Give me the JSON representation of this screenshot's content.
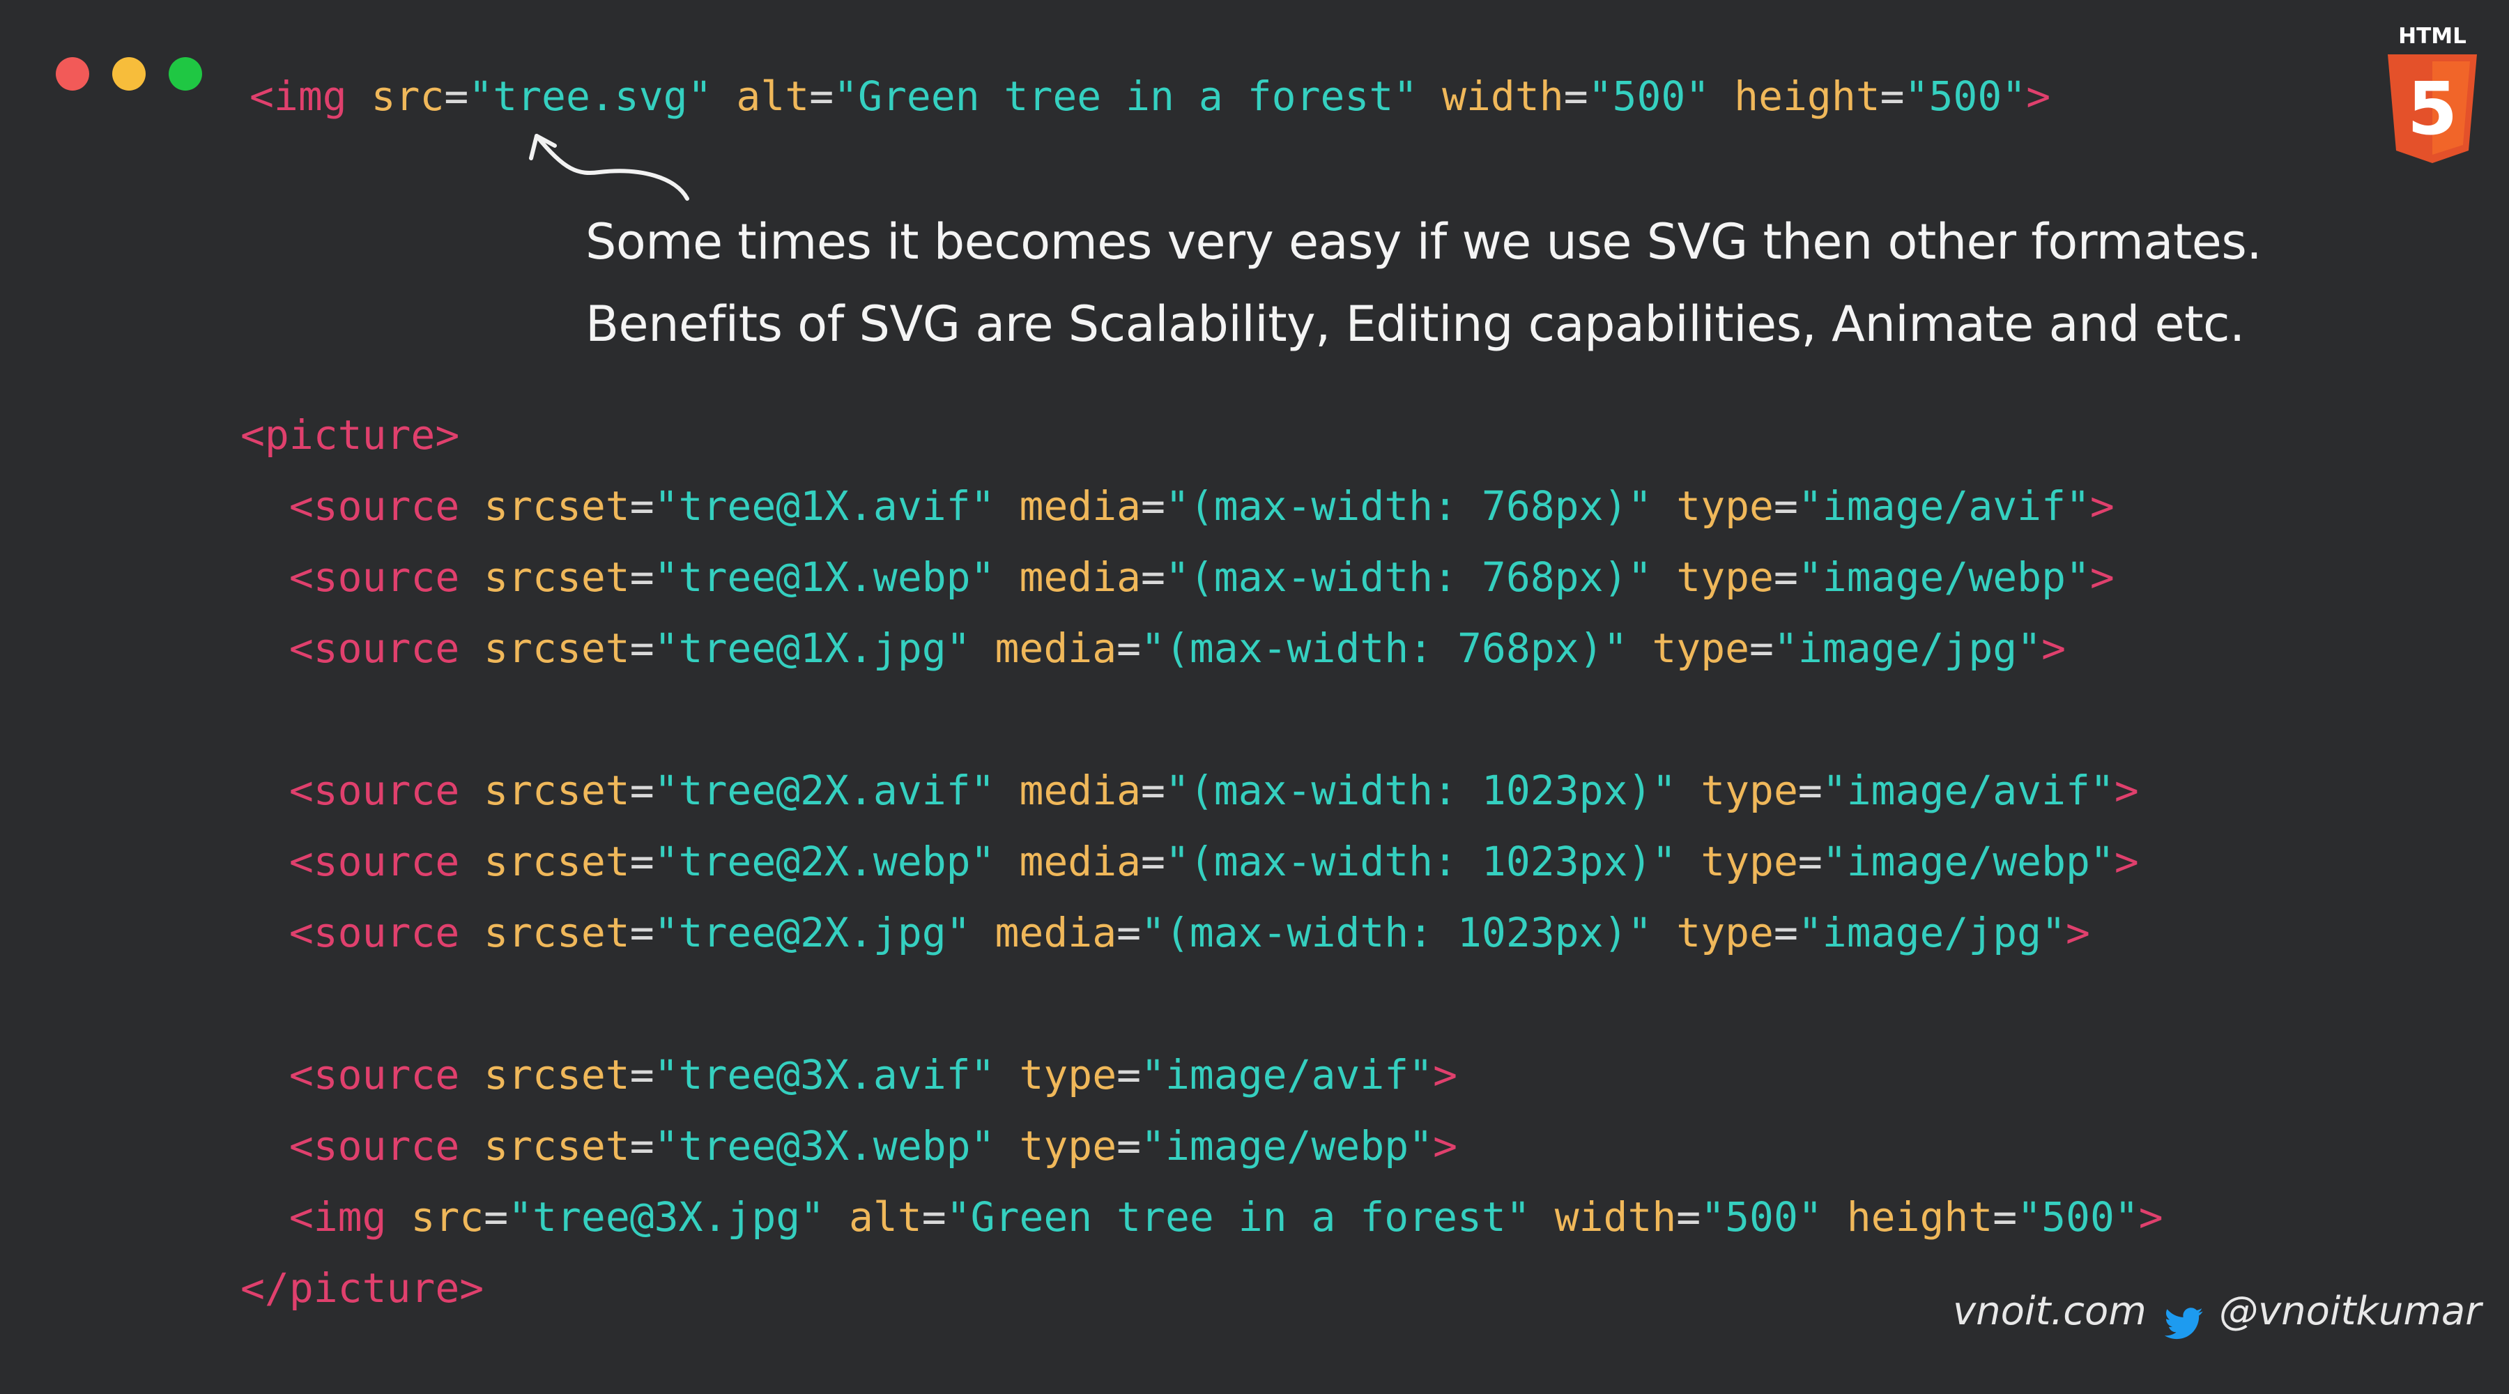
{
  "window_controls": {
    "close_color": "#f25a58",
    "minimize_color": "#f7bd3b",
    "maximize_color": "#1fc743"
  },
  "badge": {
    "label": "HTML",
    "number": "5",
    "orange": "#e4512a",
    "light_orange": "#f16529"
  },
  "code_top": {
    "line": [
      {
        "t": "tag",
        "v": "<img "
      },
      {
        "t": "attr",
        "v": "src"
      },
      {
        "t": "eq",
        "v": "="
      },
      {
        "t": "str",
        "v": "\"tree.svg\""
      },
      {
        "t": "eq",
        "v": " "
      },
      {
        "t": "attr",
        "v": "alt"
      },
      {
        "t": "eq",
        "v": "="
      },
      {
        "t": "str",
        "v": "\"Green tree in a forest\""
      },
      {
        "t": "eq",
        "v": " "
      },
      {
        "t": "attr",
        "v": "width"
      },
      {
        "t": "eq",
        "v": "="
      },
      {
        "t": "str",
        "v": "\"500\""
      },
      {
        "t": "eq",
        "v": " "
      },
      {
        "t": "attr",
        "v": "height"
      },
      {
        "t": "eq",
        "v": "="
      },
      {
        "t": "str",
        "v": "\"500\""
      },
      {
        "t": "tag",
        "v": ">"
      }
    ]
  },
  "annotation": {
    "line1": "Some times it becomes very easy if we use SVG then other formates.",
    "line2": "Benefits of SVG are Scalability, Editing capabilities, Animate and etc."
  },
  "picture_block": [
    [
      {
        "t": "tag",
        "v": "<picture>"
      }
    ],
    [
      {
        "t": "eq",
        "v": "  "
      },
      {
        "t": "tag",
        "v": "<source "
      },
      {
        "t": "attr",
        "v": "srcset"
      },
      {
        "t": "eq",
        "v": "="
      },
      {
        "t": "str",
        "v": "\"tree@1X.avif\""
      },
      {
        "t": "eq",
        "v": " "
      },
      {
        "t": "attr",
        "v": "media"
      },
      {
        "t": "eq",
        "v": "="
      },
      {
        "t": "str",
        "v": "\"(max-width: 768px)\""
      },
      {
        "t": "eq",
        "v": " "
      },
      {
        "t": "attr",
        "v": "type"
      },
      {
        "t": "eq",
        "v": "="
      },
      {
        "t": "str",
        "v": "\"image/avif\""
      },
      {
        "t": "tag",
        "v": ">"
      }
    ],
    [
      {
        "t": "eq",
        "v": "  "
      },
      {
        "t": "tag",
        "v": "<source "
      },
      {
        "t": "attr",
        "v": "srcset"
      },
      {
        "t": "eq",
        "v": "="
      },
      {
        "t": "str",
        "v": "\"tree@1X.webp\""
      },
      {
        "t": "eq",
        "v": " "
      },
      {
        "t": "attr",
        "v": "media"
      },
      {
        "t": "eq",
        "v": "="
      },
      {
        "t": "str",
        "v": "\"(max-width: 768px)\""
      },
      {
        "t": "eq",
        "v": " "
      },
      {
        "t": "attr",
        "v": "type"
      },
      {
        "t": "eq",
        "v": "="
      },
      {
        "t": "str",
        "v": "\"image/webp\""
      },
      {
        "t": "tag",
        "v": ">"
      }
    ],
    [
      {
        "t": "eq",
        "v": "  "
      },
      {
        "t": "tag",
        "v": "<source "
      },
      {
        "t": "attr",
        "v": "srcset"
      },
      {
        "t": "eq",
        "v": "="
      },
      {
        "t": "str",
        "v": "\"tree@1X.jpg\""
      },
      {
        "t": "eq",
        "v": " "
      },
      {
        "t": "attr",
        "v": "media"
      },
      {
        "t": "eq",
        "v": "="
      },
      {
        "t": "str",
        "v": "\"(max-width: 768px)\""
      },
      {
        "t": "eq",
        "v": " "
      },
      {
        "t": "attr",
        "v": "type"
      },
      {
        "t": "eq",
        "v": "="
      },
      {
        "t": "str",
        "v": "\"image/jpg\""
      },
      {
        "t": "tag",
        "v": ">"
      }
    ],
    [],
    [
      {
        "t": "eq",
        "v": "  "
      },
      {
        "t": "tag",
        "v": "<source "
      },
      {
        "t": "attr",
        "v": "srcset"
      },
      {
        "t": "eq",
        "v": "="
      },
      {
        "t": "str",
        "v": "\"tree@2X.avif\""
      },
      {
        "t": "eq",
        "v": " "
      },
      {
        "t": "attr",
        "v": "media"
      },
      {
        "t": "eq",
        "v": "="
      },
      {
        "t": "str",
        "v": "\"(max-width: 1023px)\""
      },
      {
        "t": "eq",
        "v": " "
      },
      {
        "t": "attr",
        "v": "type"
      },
      {
        "t": "eq",
        "v": "="
      },
      {
        "t": "str",
        "v": "\"image/avif\""
      },
      {
        "t": "tag",
        "v": ">"
      }
    ],
    [
      {
        "t": "eq",
        "v": "  "
      },
      {
        "t": "tag",
        "v": "<source "
      },
      {
        "t": "attr",
        "v": "srcset"
      },
      {
        "t": "eq",
        "v": "="
      },
      {
        "t": "str",
        "v": "\"tree@2X.webp\""
      },
      {
        "t": "eq",
        "v": " "
      },
      {
        "t": "attr",
        "v": "media"
      },
      {
        "t": "eq",
        "v": "="
      },
      {
        "t": "str",
        "v": "\"(max-width: 1023px)\""
      },
      {
        "t": "eq",
        "v": " "
      },
      {
        "t": "attr",
        "v": "type"
      },
      {
        "t": "eq",
        "v": "="
      },
      {
        "t": "str",
        "v": "\"image/webp\""
      },
      {
        "t": "tag",
        "v": ">"
      }
    ],
    [
      {
        "t": "eq",
        "v": "  "
      },
      {
        "t": "tag",
        "v": "<source "
      },
      {
        "t": "attr",
        "v": "srcset"
      },
      {
        "t": "eq",
        "v": "="
      },
      {
        "t": "str",
        "v": "\"tree@2X.jpg\""
      },
      {
        "t": "eq",
        "v": " "
      },
      {
        "t": "attr",
        "v": "media"
      },
      {
        "t": "eq",
        "v": "="
      },
      {
        "t": "str",
        "v": "\"(max-width: 1023px)\""
      },
      {
        "t": "eq",
        "v": " "
      },
      {
        "t": "attr",
        "v": "type"
      },
      {
        "t": "eq",
        "v": "="
      },
      {
        "t": "str",
        "v": "\"image/jpg\""
      },
      {
        "t": "tag",
        "v": ">"
      }
    ],
    [],
    [
      {
        "t": "eq",
        "v": "  "
      },
      {
        "t": "tag",
        "v": "<source "
      },
      {
        "t": "attr",
        "v": "srcset"
      },
      {
        "t": "eq",
        "v": "="
      },
      {
        "t": "str",
        "v": "\"tree@3X.avif\""
      },
      {
        "t": "eq",
        "v": " "
      },
      {
        "t": "attr",
        "v": "type"
      },
      {
        "t": "eq",
        "v": "="
      },
      {
        "t": "str",
        "v": "\"image/avif\""
      },
      {
        "t": "tag",
        "v": ">"
      }
    ],
    [
      {
        "t": "eq",
        "v": "  "
      },
      {
        "t": "tag",
        "v": "<source "
      },
      {
        "t": "attr",
        "v": "srcset"
      },
      {
        "t": "eq",
        "v": "="
      },
      {
        "t": "str",
        "v": "\"tree@3X.webp\""
      },
      {
        "t": "eq",
        "v": " "
      },
      {
        "t": "attr",
        "v": "type"
      },
      {
        "t": "eq",
        "v": "="
      },
      {
        "t": "str",
        "v": "\"image/webp\""
      },
      {
        "t": "tag",
        "v": ">"
      }
    ],
    [
      {
        "t": "eq",
        "v": "  "
      },
      {
        "t": "tag",
        "v": "<img "
      },
      {
        "t": "attr",
        "v": "src"
      },
      {
        "t": "eq",
        "v": "="
      },
      {
        "t": "str",
        "v": "\"tree@3X.jpg\""
      },
      {
        "t": "eq",
        "v": " "
      },
      {
        "t": "attr",
        "v": "alt"
      },
      {
        "t": "eq",
        "v": "="
      },
      {
        "t": "str",
        "v": "\"Green tree in a forest\""
      },
      {
        "t": "eq",
        "v": " "
      },
      {
        "t": "attr",
        "v": "width"
      },
      {
        "t": "eq",
        "v": "="
      },
      {
        "t": "str",
        "v": "\"500\""
      },
      {
        "t": "eq",
        "v": " "
      },
      {
        "t": "attr",
        "v": "height"
      },
      {
        "t": "eq",
        "v": "="
      },
      {
        "t": "str",
        "v": "\"500\""
      },
      {
        "t": "tag",
        "v": ">"
      }
    ],
    [
      {
        "t": "tag",
        "v": "</picture>"
      }
    ]
  ],
  "footer": {
    "site": "vnoit.com",
    "handle": "@vnoitkumar",
    "twitter_icon": "twitter-bird-icon",
    "twitter_color": "#1d9bf0"
  }
}
